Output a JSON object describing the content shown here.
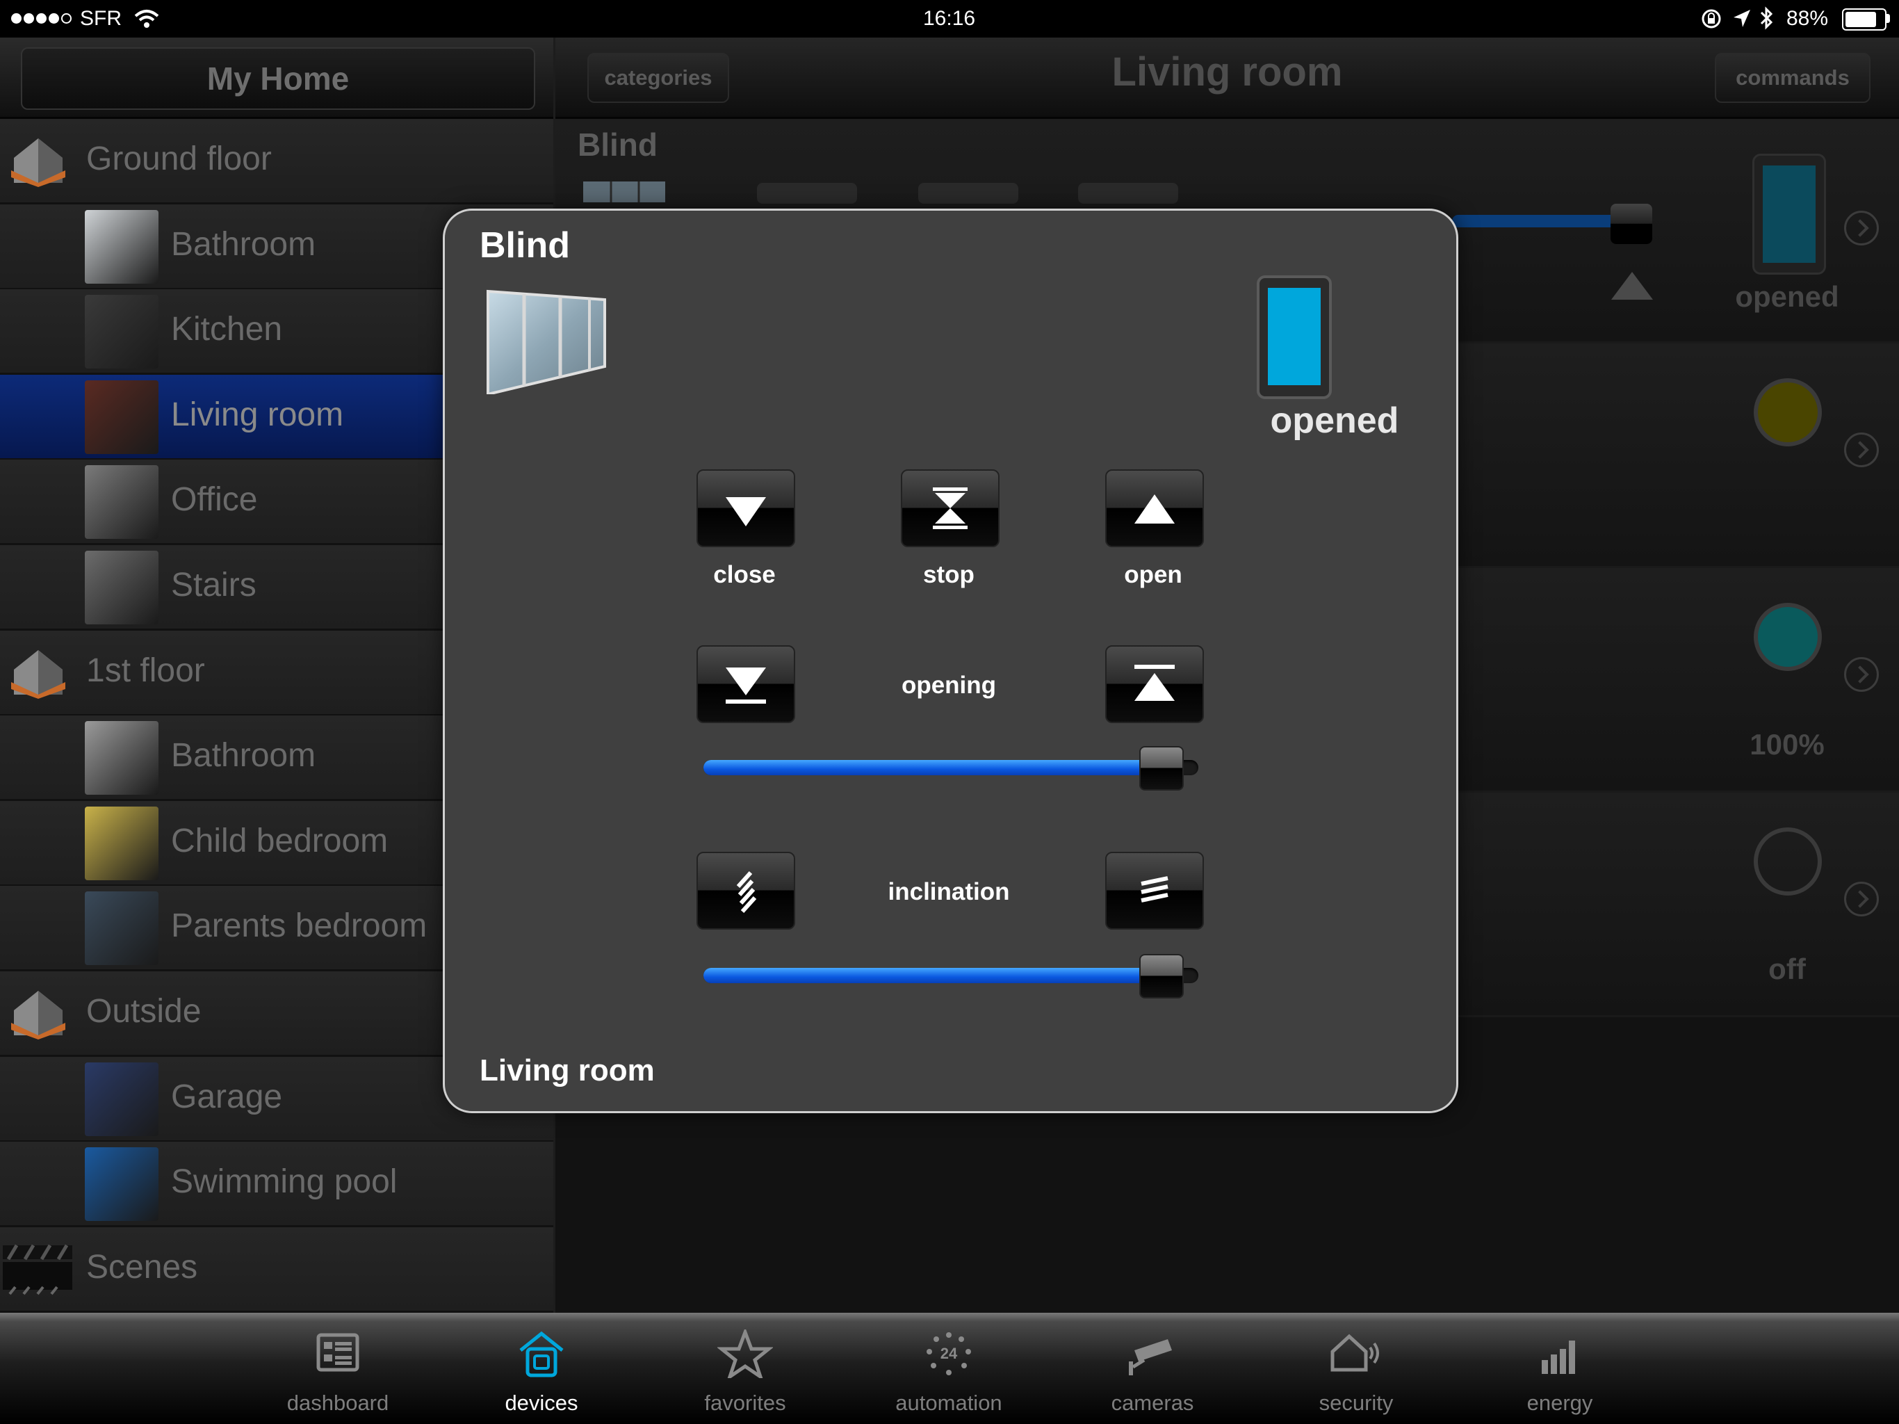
{
  "status_bar": {
    "carrier": "SFR",
    "time": "16:16",
    "battery": "88%",
    "battery_fraction": 0.88,
    "signal_bars": 4
  },
  "left_panel": {
    "title": "My Home",
    "items": [
      {
        "type": "floor",
        "label": "Ground floor"
      },
      {
        "type": "room",
        "label": "Bathroom"
      },
      {
        "type": "room",
        "label": "Kitchen"
      },
      {
        "type": "room",
        "label": "Living room",
        "selected": true
      },
      {
        "type": "room",
        "label": "Office"
      },
      {
        "type": "room",
        "label": "Stairs"
      },
      {
        "type": "floor",
        "label": "1st floor"
      },
      {
        "type": "room",
        "label": "Bathroom"
      },
      {
        "type": "room",
        "label": "Child bedroom"
      },
      {
        "type": "room",
        "label": "Parents bedroom"
      },
      {
        "type": "floor",
        "label": "Outside"
      },
      {
        "type": "room",
        "label": "Garage"
      },
      {
        "type": "room",
        "label": "Swimming pool"
      },
      {
        "type": "scenes",
        "label": "Scenes"
      }
    ]
  },
  "right_panel": {
    "categories_label": "categories",
    "title": "Living room",
    "commands_label": "commands",
    "devices": [
      {
        "name": "Blind",
        "state": "opened"
      },
      {
        "name": "",
        "state": ""
      },
      {
        "name": "",
        "state": "100%"
      },
      {
        "name": "",
        "state": "off"
      }
    ]
  },
  "modal": {
    "title": "Blind",
    "room": "Living room",
    "state": "opened",
    "controls": {
      "close": "close",
      "stop": "stop",
      "open": "open"
    },
    "opening": {
      "label": "opening",
      "value": 0.92
    },
    "inclination": {
      "label": "inclination",
      "value": 0.92
    }
  },
  "colors": {
    "accent_blue": "#00a7dc",
    "slider_blue": "#1a73ff",
    "selected_row": "#0a2164"
  },
  "tabs": [
    {
      "label": "dashboard",
      "icon": "dashboard-icon"
    },
    {
      "label": "devices",
      "icon": "devices-icon",
      "active": true
    },
    {
      "label": "favorites",
      "icon": "star-icon"
    },
    {
      "label": "automation",
      "icon": "clock-24-icon"
    },
    {
      "label": "cameras",
      "icon": "camera-icon"
    },
    {
      "label": "security",
      "icon": "home-alarm-icon"
    },
    {
      "label": "energy",
      "icon": "bar-chart-icon"
    }
  ]
}
